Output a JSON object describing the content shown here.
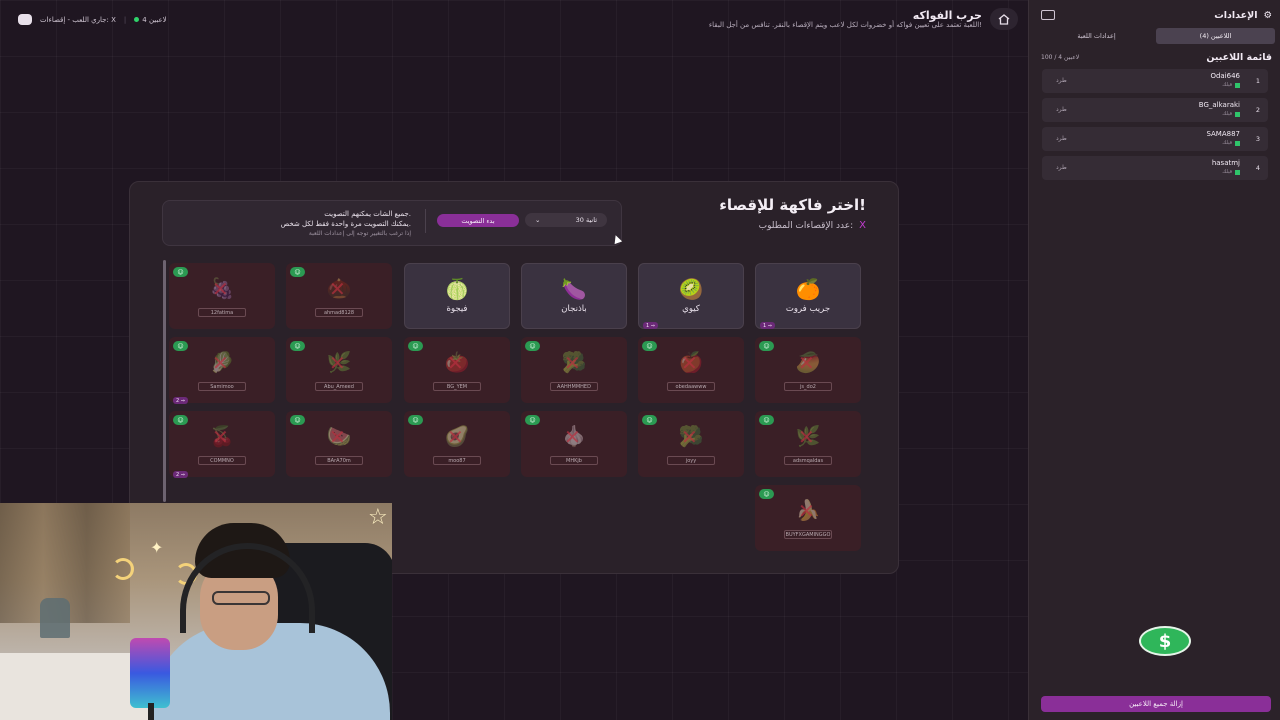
{
  "topbar": {
    "title": "حرب الفواكه",
    "description": "اللعبة تعتمد على تعيين فواكه أو خضروات لكل لاعب ويتم الإقصاء بالنقر. تنافس من أجل البقاء!",
    "players_online": "4 لاعبين",
    "status": "جاري اللعب - إقصاءات: X"
  },
  "panel": {
    "title": "اختر فاكهة للإقصاء!",
    "subtitle": "عدد الإقصاءات المطلوب:",
    "subtitle_value": "X",
    "vote_line1": "جميع الشات يمكنهم التصويت.",
    "vote_line2": "يمكنك التصويت مرة واحدة فقط لكل شخص.",
    "vote_hint": "إذا ترغب بالتغيير توجه إلى إعدادات اللعبة",
    "vote_button": "بدء التصويت",
    "timer_value": "30 ثانية",
    "timer_icon": "chevron-down-icon"
  },
  "cards": [
    {
      "name": "جريب فروت",
      "emoji": "🍊",
      "state": "active",
      "count": "1 ⇒"
    },
    {
      "name": "كيوي",
      "emoji": "🥝",
      "state": "active",
      "count": "1 ⇒"
    },
    {
      "name": "باذنجان",
      "emoji": "🍆",
      "state": "active"
    },
    {
      "name": "فيجوة",
      "emoji": "🍈",
      "state": "active"
    },
    {
      "player": "ahmad8128",
      "emoji": "🌰",
      "state": "elim"
    },
    {
      "player": "12fatima",
      "emoji": "🍇",
      "state": "elim"
    },
    {
      "player": "js_do2",
      "emoji": "🥭",
      "state": "elim"
    },
    {
      "player": "obedaawww",
      "emoji": "🍎",
      "state": "elim"
    },
    {
      "player": "AAHHMMHED",
      "emoji": "🥦",
      "state": "elim"
    },
    {
      "player": "BG_YEM",
      "emoji": "🍅",
      "state": "elim"
    },
    {
      "player": "Abu_Ameed",
      "emoji": "🌿",
      "state": "elim"
    },
    {
      "player": "Samimoo",
      "emoji": "🥬",
      "state": "elim",
      "count": "2 ⇒"
    },
    {
      "player": "adsmqaldas",
      "emoji": "🌿",
      "state": "elim"
    },
    {
      "player": "joyy",
      "emoji": "🥦",
      "state": "elim"
    },
    {
      "player": "MHKjb",
      "emoji": "🧄",
      "state": "elim"
    },
    {
      "player": "moo87",
      "emoji": "🥑",
      "state": "elim"
    },
    {
      "player": "BArA70m",
      "emoji": "🍉",
      "state": "elim"
    },
    {
      "player": "COMMNO",
      "emoji": "🍒",
      "state": "elim",
      "count": "2 ⇒"
    },
    {
      "player": "BUYFXGAMINGGO",
      "emoji": "🍌",
      "state": "elim"
    }
  ],
  "sidebar": {
    "title": "الإعدادات",
    "tabs": [
      "اللاعبين (4)",
      "إعدادات اللعبة"
    ],
    "list_title": "قائمة اللاعبين",
    "list_count": "100 / 4 لاعبين",
    "players": [
      {
        "idx": "1",
        "name": "Odai646",
        "status": "قيلك",
        "kick": "طرد"
      },
      {
        "idx": "2",
        "name": "BG_alkaraki",
        "status": "قيلك",
        "kick": "طرد"
      },
      {
        "idx": "3",
        "name": "SAMA887",
        "status": "قيلك",
        "kick": "طرد"
      },
      {
        "idx": "4",
        "name": "hasatmj",
        "status": "قيلك",
        "kick": "طرد"
      }
    ],
    "dollar": "$",
    "remove_all": "إزالة جميع اللاعبين"
  },
  "colors": {
    "accent": "#8a2f98",
    "green": "#2fb65a",
    "danger": "#b8303f"
  }
}
